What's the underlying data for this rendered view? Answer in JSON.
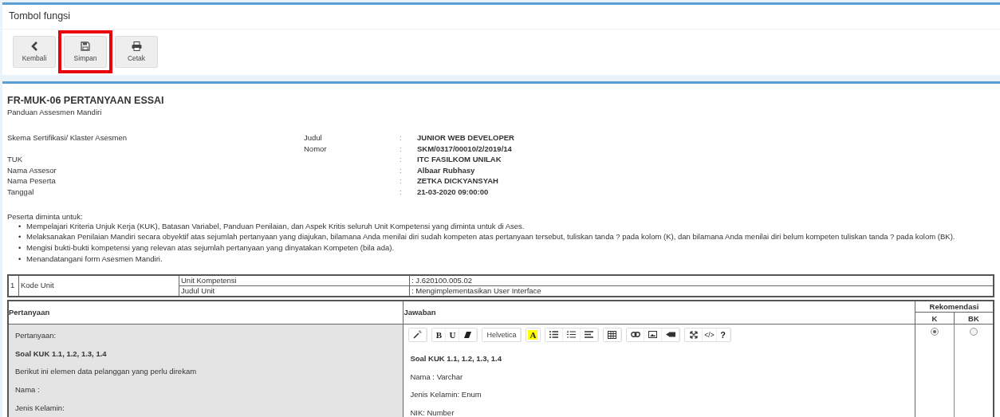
{
  "function_panel": {
    "title": "Tombol fungsi",
    "buttons": [
      {
        "label": "Kembali",
        "highlighted": false
      },
      {
        "label": "Simpan",
        "highlighted": true
      },
      {
        "label": "Cetak",
        "highlighted": false
      }
    ]
  },
  "form": {
    "title": "FR-MUK-06 PERTANYAAN ESSAI",
    "subtitle": "Panduan Assesmen Mandiri",
    "info": [
      {
        "label": "Skema Sertifikasi/ Klaster Asesmen",
        "sublabel": "Judul",
        "value": "JUNIOR WEB DEVELOPER"
      },
      {
        "sublabel": "Nomor",
        "value": "SKM/0317/00010/2/2019/14"
      },
      {
        "label": "TUK",
        "value": "ITC FASILKOM UNILAK"
      },
      {
        "label": "Nama Assesor",
        "value": "Albaar Rubhasy"
      },
      {
        "label": "Nama Peserta",
        "value": "ZETKA DICKYANSYAH"
      },
      {
        "label": "Tanggal",
        "value": "21-03-2020 09:00:00"
      }
    ],
    "separator": ":",
    "instructions_intro": "Peserta diminta untuk:",
    "bullet": "•",
    "instructions": [
      "Mempelajari Kriteria Unjuk Kerja (KUK), Batasan Variabel, Panduan Penilaian, dan Aspek Kritis seluruh Unit Kompetensi yang diminta untuk di Ases.",
      "Melaksanakan Penilaian Mandiri secara obyektif atas sejumlah pertanyaan yang diajukan, bilamana Anda menilai diri sudah kompeten atas pertanyaan tersebut, tuliskan tanda ? pada kolom (K), dan bilamana Anda menilai diri belum kompeten tuliskan tanda ? pada kolom (BK).",
      "Mengisi bukti-bukti kompetensi yang relevan atas sejumlah pertanyaan yang dinyatakan Kompeten (bila ada).",
      "Menandatangani form Asesmen Mandiri."
    ],
    "unit": {
      "number": "1",
      "label": "Kode Unit",
      "rows": [
        {
          "label": "Unit Kompetensi",
          "value": ": J.620100.005.02"
        },
        {
          "label": "Judul Unit",
          "value": ": Mengimplementasikan User Interface"
        }
      ]
    },
    "table": {
      "columns": [
        "Pertanyaan",
        "Jawaban",
        "Rekomendasi"
      ],
      "sub_columns": [
        "K",
        "BK"
      ],
      "rows": [
        {
          "question": [
            "Pertanyaan:",
            "Soal KUK 1.1, 1.2, 1.3, 1.4",
            "Berikut ini elemen data pelanggan yang perlu direkam",
            "Nama :",
            "Jenis Kelamin:"
          ],
          "answer": [
            "Soal KUK 1.1, 1.2, 1.3, 1.4",
            "Nama : Varchar",
            "Jenis Kelamin: Enum",
            "NIK: Number"
          ],
          "recommendation": [
            {
              "selected": true
            },
            {
              "selected": false
            }
          ]
        }
      ],
      "editor_toolbar": {
        "bold": "B",
        "underline": "U",
        "font": "Helvetica",
        "highlight_button": "A",
        "code": "</>",
        "help": "?"
      }
    }
  }
}
